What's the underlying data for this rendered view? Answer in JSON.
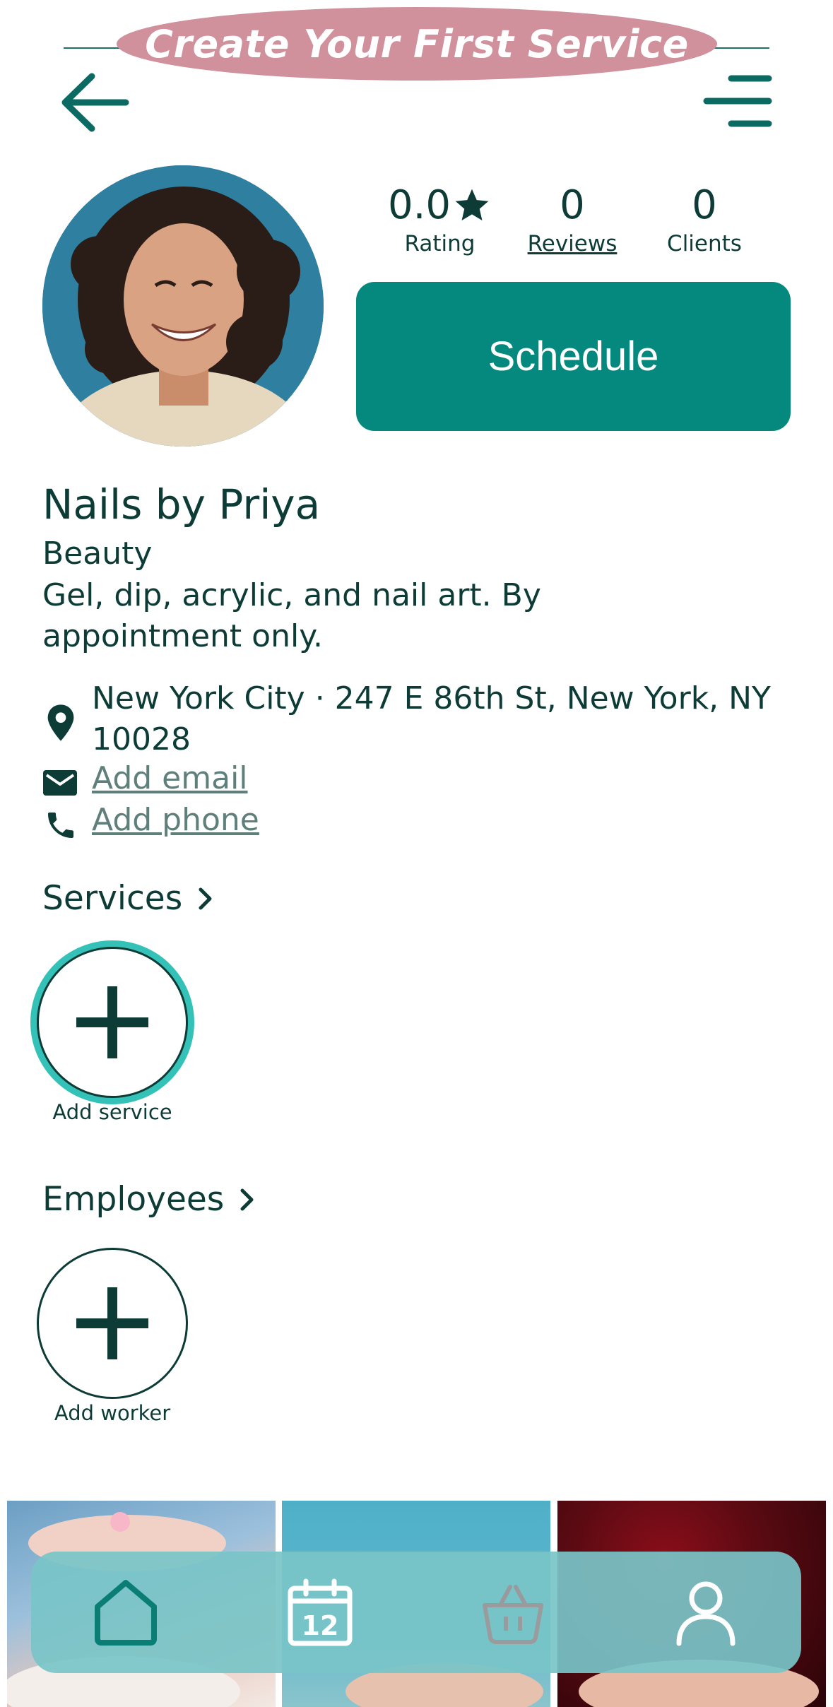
{
  "banner": {
    "title": "Create Your First Service"
  },
  "stats": {
    "rating_value": "0.0",
    "rating_label": "Rating",
    "reviews_value": "0",
    "reviews_label": "Reviews",
    "clients_value": "0",
    "clients_label": "Clients"
  },
  "schedule_button": {
    "label": "Schedule"
  },
  "business": {
    "name": "Nails by Priya",
    "category": "Beauty",
    "description": "Gel, dip, acrylic, and nail art. By appointment only."
  },
  "contact": {
    "address": "New York City · 247 E 86th St, New York, NY 10028",
    "email_link": "Add email",
    "phone_link": "Add phone"
  },
  "services": {
    "title": "Services",
    "add_label": "Add service"
  },
  "employees": {
    "title": "Employees",
    "add_label": "Add worker"
  },
  "nav": {
    "items": [
      {
        "icon": "home-icon"
      },
      {
        "icon": "calendar-icon",
        "calendar_day": "12"
      },
      {
        "icon": "basket-icon"
      },
      {
        "icon": "user-icon"
      }
    ]
  },
  "colors": {
    "accent": "#05887e",
    "text": "#0d3b36",
    "banner": "#d0909c",
    "nav_bg": "#78c4c8"
  }
}
